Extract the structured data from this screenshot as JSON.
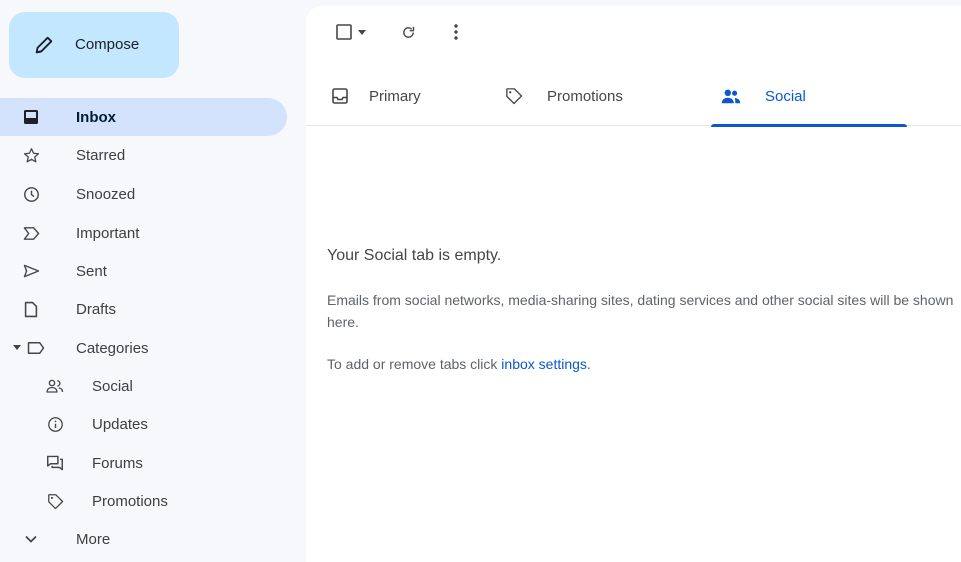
{
  "compose": {
    "label": "Compose",
    "icon": "pencil-icon"
  },
  "sidebar": {
    "items": [
      {
        "label": "Inbox",
        "icon": "inbox-icon",
        "active": true
      },
      {
        "label": "Starred",
        "icon": "star-icon"
      },
      {
        "label": "Snoozed",
        "icon": "clock-icon"
      },
      {
        "label": "Important",
        "icon": "important-icon"
      },
      {
        "label": "Sent",
        "icon": "send-icon"
      },
      {
        "label": "Drafts",
        "icon": "draft-icon"
      },
      {
        "label": "Categories",
        "icon": "label-icon"
      },
      {
        "label": "Social",
        "icon": "people-icon"
      },
      {
        "label": "Updates",
        "icon": "info-icon"
      },
      {
        "label": "Forums",
        "icon": "forum-icon"
      },
      {
        "label": "Promotions",
        "icon": "tag-icon"
      },
      {
        "label": "More",
        "icon": "chevron-down-icon"
      }
    ]
  },
  "toolbar": {
    "select_icon": "checkbox-icon",
    "refresh_icon": "refresh-icon",
    "more_icon": "more-vert-icon"
  },
  "tabs": [
    {
      "label": "Primary",
      "icon": "inbox-icon"
    },
    {
      "label": "Promotions",
      "icon": "tag-icon"
    },
    {
      "label": "Social",
      "icon": "people-icon",
      "active": true
    }
  ],
  "empty_state": {
    "title": "Your Social tab is empty.",
    "body": "Emails from social networks, media-sharing sites, dating services and other social sites will be shown here.",
    "hint_prefix": "To add or remove tabs click ",
    "hint_link": "inbox settings",
    "hint_suffix": "."
  },
  "colors": {
    "accent": "#0b57d0",
    "compose_bg": "#c2e7ff",
    "active_nav_bg": "#d3e3fd",
    "sidebar_bg": "#f6f8fc"
  }
}
